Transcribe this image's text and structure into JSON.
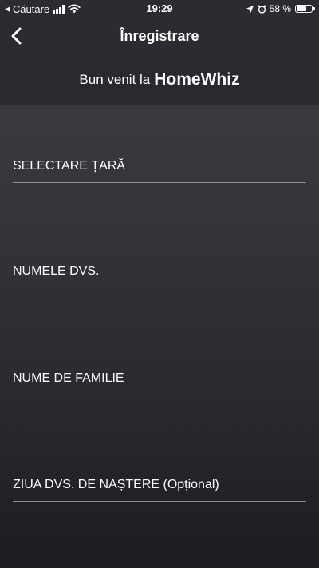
{
  "status_bar": {
    "back_label": "Căutare",
    "time": "19:29",
    "battery_text": "58 %"
  },
  "nav": {
    "title": "Înregistrare"
  },
  "welcome": {
    "prefix": "Bun venit la",
    "brand": "HomeWhiz"
  },
  "form": {
    "fields": [
      {
        "label": "SELECTARE ȚARĂ"
      },
      {
        "label": "NUMELE DVS."
      },
      {
        "label": "NUME DE FAMILIE"
      },
      {
        "label": "ZIUA DVS. DE NAȘTERE (Opțional)"
      }
    ]
  },
  "colors": {
    "header_bg": "#2b2c30",
    "banner_bg": "#282a2e",
    "text": "#ffffff",
    "underline": "#8b8d92"
  },
  "icons": [
    "back-triangle-icon",
    "signal-icon",
    "wifi-icon",
    "location-arrow-icon",
    "alarm-icon",
    "battery-icon",
    "chevron-left-icon"
  ]
}
